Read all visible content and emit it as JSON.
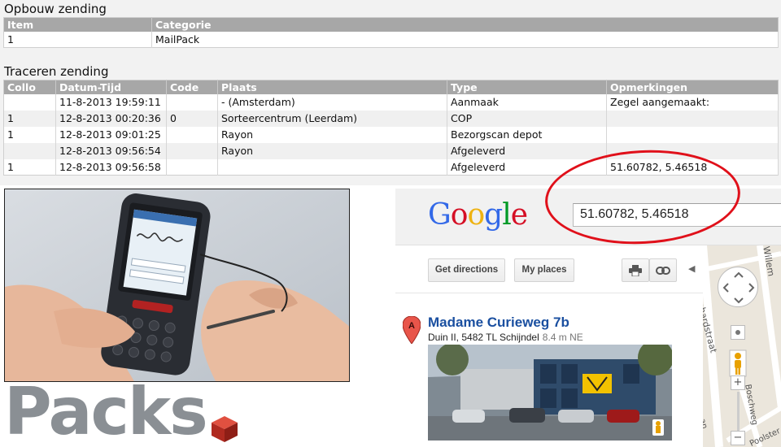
{
  "opbouw": {
    "title": "Opbouw zending",
    "columns": [
      "Item",
      "Categorie"
    ],
    "rows": [
      [
        "1",
        "MailPack"
      ]
    ]
  },
  "traceren": {
    "title": "Traceren zending",
    "columns": [
      "Collo",
      "Datum-Tijd",
      "Code",
      "Plaats",
      "Type",
      "Opmerkingen"
    ],
    "rows": [
      [
        "",
        "11-8-2013 19:59:11",
        "",
        "- (Amsterdam)",
        "Aanmaak",
        "Zegel aangemaakt:"
      ],
      [
        "1",
        "12-8-2013 00:20:36",
        "0",
        "Sorteercentrum (Leerdam)",
        "COP",
        ""
      ],
      [
        "1",
        "12-8-2013 09:01:25",
        "",
        "Rayon",
        "Bezorgscan depot",
        ""
      ],
      [
        "",
        "12-8-2013 09:56:54",
        "",
        "Rayon",
        "Afgeleverd",
        ""
      ],
      [
        "1",
        "12-8-2013 09:56:58",
        "",
        "",
        "Afgeleverd",
        "51.60782, 5.46518"
      ]
    ]
  },
  "logo": {
    "text": "Packs"
  },
  "google": {
    "logo_letters": [
      "G",
      "o",
      "o",
      "g",
      "l",
      "e"
    ],
    "search_value": "51.60782, 5.46518",
    "buttons": {
      "directions": "Get directions",
      "myplaces": "My places"
    },
    "result": {
      "marker": "A",
      "title": "Madame Curieweg 7b",
      "address": "Duin II, 5482 TL Schijndel",
      "distance": "8.4 m NE"
    },
    "map_labels": {
      "street1": "Bernhardstraat",
      "street2": "Willem",
      "street3": "Boschweg",
      "street4": "an",
      "street5": "Poolster"
    },
    "map_controls": {
      "zoom_in": "+",
      "zoom_out": "−"
    }
  },
  "colors": {
    "table_header": "#a7a7a7",
    "annotation": "#e0101a",
    "google_blue": "#3369e8",
    "google_red": "#d50f25",
    "google_yellow": "#eeb211",
    "google_green": "#009925",
    "result_link": "#1a4fa0",
    "logo_grey": "#8a8f94",
    "cube_red": "#c0392b"
  },
  "icons": {
    "print": "printer-icon",
    "link": "link-icon",
    "marker": "map-marker-icon",
    "pegman": "pegman-icon",
    "cube": "cube-icon"
  }
}
